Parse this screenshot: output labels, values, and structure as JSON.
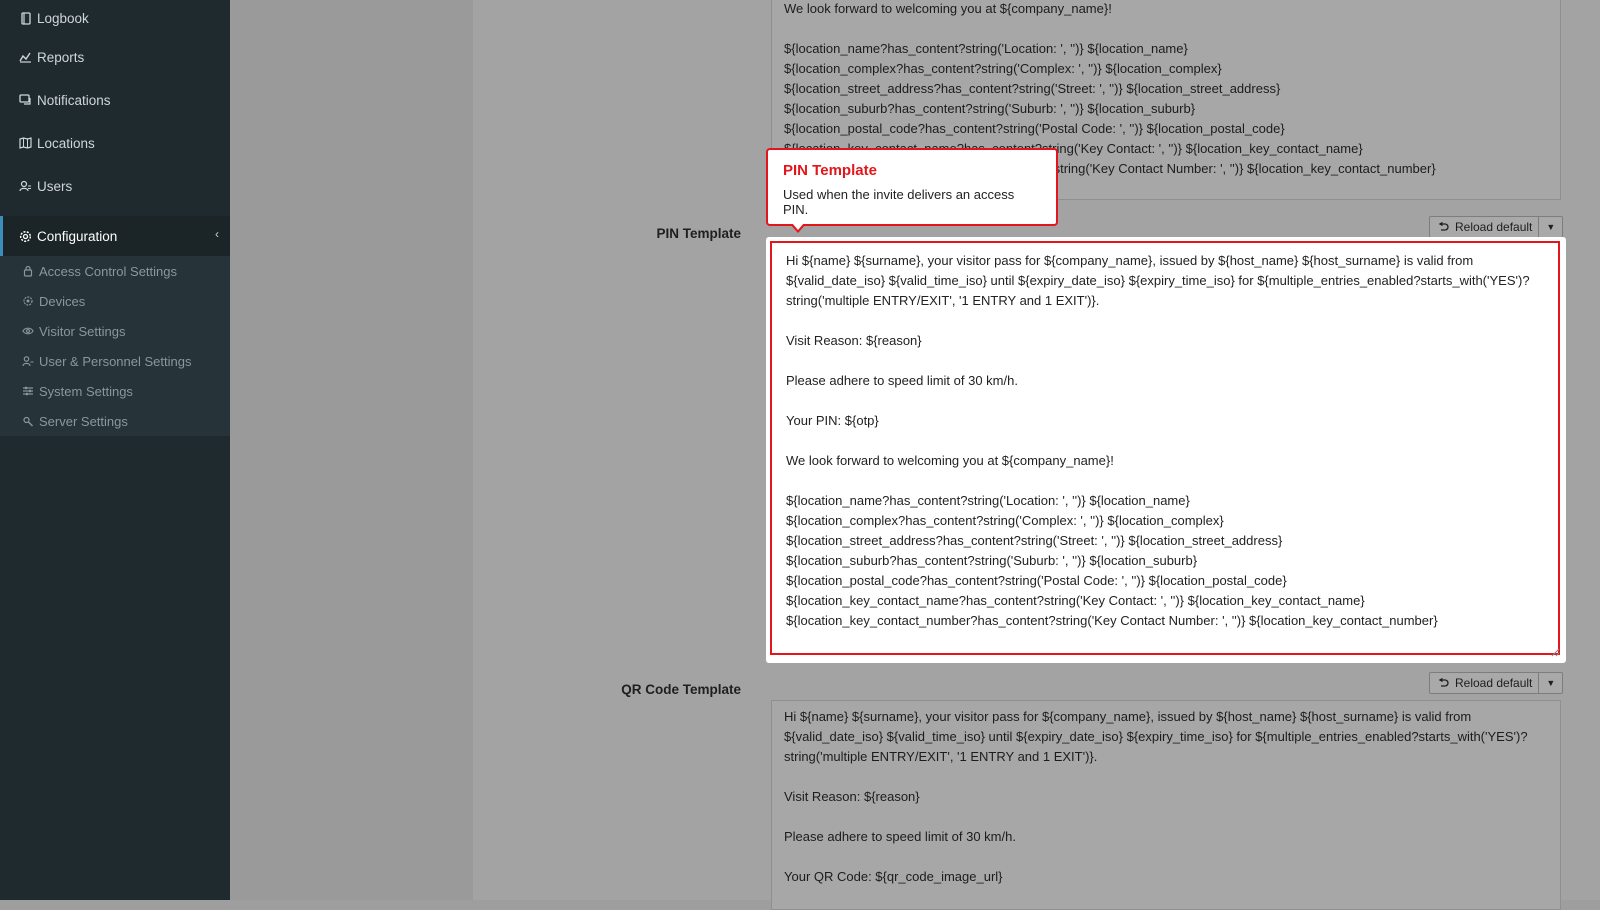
{
  "sidebar": {
    "items": [
      {
        "label": "Logbook",
        "icon": "book-icon"
      },
      {
        "label": "Reports",
        "icon": "chart-icon"
      },
      {
        "label": "Notifications",
        "icon": "chat-icon"
      },
      {
        "label": "Locations",
        "icon": "map-icon"
      },
      {
        "label": "Users",
        "icon": "users-icon"
      },
      {
        "label": "Configuration",
        "icon": "gear-icon"
      }
    ],
    "submenu": [
      {
        "label": "Access Control Settings",
        "icon": "lock-icon"
      },
      {
        "label": "Devices",
        "icon": "device-icon"
      },
      {
        "label": "Visitor Settings",
        "icon": "eye-icon"
      },
      {
        "label": "User & Personnel Settings",
        "icon": "users-icon"
      },
      {
        "label": "System Settings",
        "icon": "sliders-icon"
      },
      {
        "label": "Server Settings",
        "icon": "server-icon"
      }
    ]
  },
  "top_textarea": {
    "text": "We look forward to welcoming you at ${company_name}!\n\n${location_name?has_content?string('Location: ', '')} ${location_name}\n${location_complex?has_content?string('Complex: ', '')} ${location_complex}\n${location_street_address?has_content?string('Street: ', '')} ${location_street_address}\n${location_suburb?has_content?string('Suburb: ', '')} ${location_suburb}\n${location_postal_code?has_content?string('Postal Code: ', '')} ${location_postal_code}\n${location_key_contact_name?has_content?string('Key Contact: ', '')} ${location_key_contact_name}\n${location_key_contact_number?has_content?string('Key Contact Number: ', '')} ${location_key_contact_number}"
  },
  "pin_template": {
    "label": "PIN Template",
    "reload_label": "Reload default",
    "text": "Hi ${name} ${surname}, your visitor pass for ${company_name}, issued by ${host_name} ${host_surname} is valid from ${valid_date_iso} ${valid_time_iso} until ${expiry_date_iso} ${expiry_time_iso} for ${multiple_entries_enabled?starts_with('YES')?string('multiple ENTRY/EXIT', '1 ENTRY and 1 EXIT')}.\n\nVisit Reason: ${reason}\n\nPlease adhere to speed limit of 30 km/h.\n\nYour PIN: ${otp}\n\nWe look forward to welcoming you at ${company_name}!\n\n${location_name?has_content?string('Location: ', '')} ${location_name}\n${location_complex?has_content?string('Complex: ', '')} ${location_complex}\n${location_street_address?has_content?string('Street: ', '')} ${location_street_address}\n${location_suburb?has_content?string('Suburb: ', '')} ${location_suburb}\n${location_postal_code?has_content?string('Postal Code: ', '')} ${location_postal_code}\n${location_key_contact_name?has_content?string('Key Contact: ', '')} ${location_key_contact_name}\n${location_key_contact_number?has_content?string('Key Contact Number: ', '')} ${location_key_contact_number}"
  },
  "qr_template": {
    "label": "QR Code Template",
    "reload_label": "Reload default",
    "text": "Hi ${name} ${surname}, your visitor pass for ${company_name}, issued by ${host_name} ${host_surname} is valid from ${valid_date_iso} ${valid_time_iso} until ${expiry_date_iso} ${expiry_time_iso} for ${multiple_entries_enabled?starts_with('YES')?string('multiple ENTRY/EXIT', '1 ENTRY and 1 EXIT')}.\n\nVisit Reason: ${reason}\n\nPlease adhere to speed limit of 30 km/h.\n\nYour QR Code: ${qr_code_image_url}"
  },
  "tooltip": {
    "title": "PIN Template",
    "text": "Used when the invite delivers an access PIN."
  },
  "colors": {
    "highlight": "#e3161c",
    "sidebar_bg": "#1f2a2e",
    "active_accent": "#3c8dbc"
  }
}
